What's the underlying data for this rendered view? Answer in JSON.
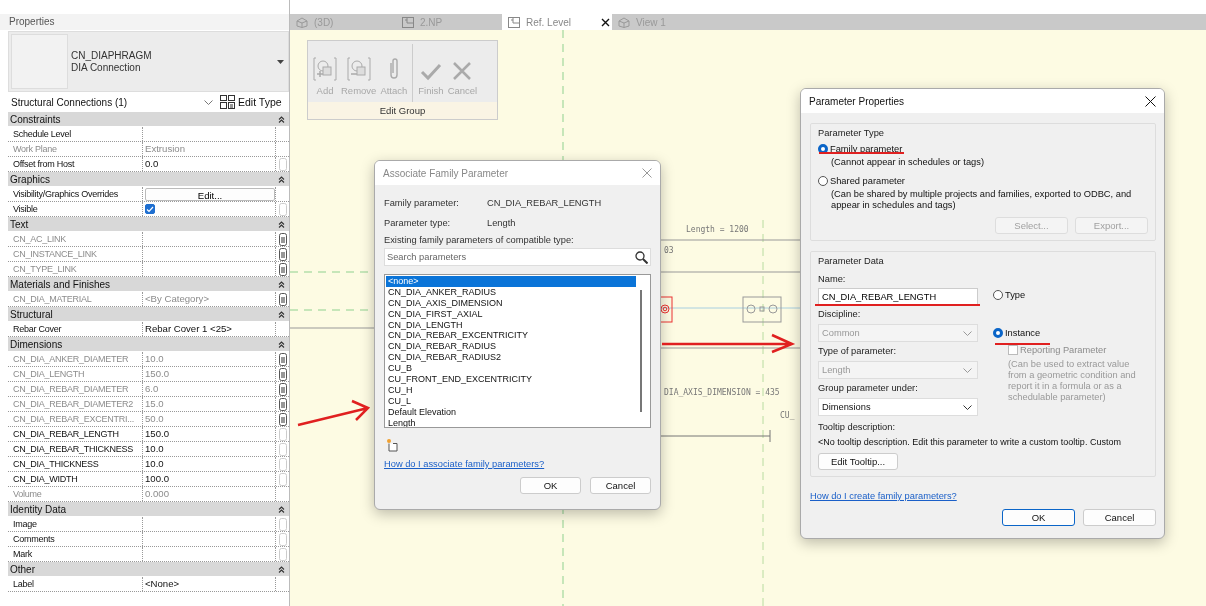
{
  "properties": {
    "title": "Properties",
    "type_name": "CN_DIAPHRAGM",
    "type_sub": "DIA Connection",
    "selector": "Structural Connections (1)",
    "edit_type": "Edit Type",
    "groups": [
      {
        "name": "Constraints",
        "expanded": true,
        "rows": [
          {
            "label": "Schedule Level",
            "kind": "text",
            "disabled": false
          },
          {
            "label": "Work Plane",
            "value": "Extrusion",
            "kind": "text",
            "disabled": true
          },
          {
            "label": "Offset from Host",
            "value": "0.0",
            "kind": "text",
            "disabled": false,
            "linked": false
          }
        ]
      },
      {
        "name": "Graphics",
        "expanded": true,
        "rows": [
          {
            "label": "Visibility/Graphics Overrides",
            "value": "Edit...",
            "kind": "button",
            "disabled": false
          },
          {
            "label": "Visible",
            "kind": "checkbox",
            "checked": true,
            "disabled": false,
            "linked": false
          }
        ]
      },
      {
        "name": "Text",
        "expanded": true,
        "rows": [
          {
            "label": "CN_AC_LINK",
            "kind": "text",
            "disabled": true,
            "linked": true
          },
          {
            "label": "CN_INSTANCE_LINK",
            "kind": "text",
            "disabled": true,
            "linked": true
          },
          {
            "label": "CN_TYPE_LINK",
            "kind": "text",
            "disabled": true,
            "linked": true
          }
        ]
      },
      {
        "name": "Materials and Finishes",
        "expanded": true,
        "rows": [
          {
            "label": "CN_DIA_MATERIAL",
            "value": "<By Category>",
            "kind": "text",
            "disabled": true,
            "linked": true
          }
        ]
      },
      {
        "name": "Structural",
        "expanded": true,
        "rows": [
          {
            "label": "Rebar Cover",
            "value": "Rebar Cover 1 <25>",
            "kind": "text",
            "disabled": false
          }
        ]
      },
      {
        "name": "Dimensions",
        "expanded": true,
        "rows": [
          {
            "label": "CN_DIA_ANKER_DIAMETER",
            "value": "10.0",
            "kind": "text",
            "disabled": true,
            "linked": true
          },
          {
            "label": "CN_DIA_LENGTH",
            "value": "150.0",
            "kind": "text",
            "disabled": true,
            "linked": true
          },
          {
            "label": "CN_DIA_REBAR_DIAMETER",
            "value": "6.0",
            "kind": "text",
            "disabled": true,
            "linked": true
          },
          {
            "label": "CN_DIA_REBAR_DIAMETER2",
            "value": "15.0",
            "kind": "text",
            "disabled": true,
            "linked": true
          },
          {
            "label": "CN_DIA_REBAR_EXCENTRI...",
            "value": "50.0",
            "kind": "text",
            "disabled": true,
            "linked": true
          },
          {
            "label": "CN_DIA_REBAR_LENGTH",
            "value": "150.0",
            "kind": "text",
            "disabled": false,
            "linked": false
          },
          {
            "label": "CN_DIA_REBAR_THICKNESS",
            "value": "10.0",
            "kind": "text",
            "disabled": false,
            "linked": false
          },
          {
            "label": "CN_DIA_THICKNESS",
            "value": "10.0",
            "kind": "text",
            "disabled": false,
            "linked": false
          },
          {
            "label": "CN_DIA_WIDTH",
            "value": "100.0",
            "kind": "text",
            "disabled": false,
            "linked": false
          },
          {
            "label": "Volume",
            "value": "0.000",
            "kind": "text",
            "disabled": true
          }
        ]
      },
      {
        "name": "Identity Data",
        "expanded": true,
        "rows": [
          {
            "label": "Image",
            "kind": "text",
            "disabled": false,
            "linked": false
          },
          {
            "label": "Comments",
            "kind": "text",
            "disabled": false,
            "linked": false
          },
          {
            "label": "Mark",
            "kind": "text",
            "disabled": false,
            "linked": false
          }
        ]
      },
      {
        "name": "Other",
        "expanded": true,
        "rows": [
          {
            "label": "Label",
            "value": "<None>",
            "kind": "text",
            "disabled": false
          }
        ]
      }
    ]
  },
  "tabs": [
    {
      "label": "(3D)",
      "kind": "perspective",
      "selected": false
    },
    {
      "label": "2.NP",
      "kind": "plan",
      "selected": false
    },
    {
      "label": "Ref. Level",
      "kind": "plan",
      "selected": true
    },
    {
      "label": "View 1",
      "kind": "perspective",
      "selected": false
    }
  ],
  "edit_group": {
    "title": "Edit Group",
    "buttons": [
      {
        "label": "Add",
        "kind": "add",
        "disabled": true
      },
      {
        "label": "Remove",
        "kind": "remove",
        "disabled": true
      },
      {
        "label": "Attach",
        "kind": "attach",
        "disabled": true
      },
      {
        "label": "Finish",
        "kind": "finish",
        "disabled": true
      },
      {
        "label": "Cancel",
        "kind": "cancel",
        "disabled": true
      }
    ]
  },
  "canvas": {
    "labels": [
      "Length = 1200",
      "03",
      "DIA_AXIS_DIMENSION = 435",
      "CU_"
    ]
  },
  "associate_dialog": {
    "title": "Associate Family Parameter",
    "active": false,
    "fields": [
      {
        "label": "Family parameter:",
        "value": "CN_DIA_REBAR_LENGTH"
      },
      {
        "label": "Parameter type:",
        "value": "Length"
      }
    ],
    "list_label": "Existing family parameters of compatible type:",
    "search_placeholder": "Search parameters",
    "items": [
      {
        "label": "<none>",
        "selected": true
      },
      {
        "label": "CN_DIA_ANKER_RADIUS",
        "selected": false
      },
      {
        "label": "CN_DIA_AXIS_DIMENSION",
        "selected": false
      },
      {
        "label": "CN_DIA_FIRST_AXIAL",
        "selected": false
      },
      {
        "label": "CN_DIA_LENGTH",
        "selected": false
      },
      {
        "label": "CN_DIA_REBAR_EXCENTRICITY",
        "selected": false
      },
      {
        "label": "CN_DIA_REBAR_RADIUS",
        "selected": false
      },
      {
        "label": "CN_DIA_REBAR_RADIUS2",
        "selected": false
      },
      {
        "label": "CU_B",
        "selected": false
      },
      {
        "label": "CU_FRONT_END_EXCENTRICITY",
        "selected": false
      },
      {
        "label": "CU_H",
        "selected": false
      },
      {
        "label": "CU_L",
        "selected": false
      },
      {
        "label": "Default Elevation",
        "selected": false
      },
      {
        "label": "Length",
        "selected": false
      }
    ],
    "help_link": "How do I associate family parameters?",
    "ok": "OK",
    "cancel": "Cancel"
  },
  "parameter_dialog": {
    "title": "Parameter Properties",
    "active": true,
    "type_legend": "Parameter Type",
    "type_options": [
      {
        "label": "Family parameter",
        "note": "(Cannot appear in schedules or tags)",
        "selected": true
      },
      {
        "label": "Shared parameter",
        "note": "(Can be shared by multiple projects and families, exported to ODBC, and appear in schedules and tags)",
        "selected": false
      }
    ],
    "select_button": {
      "label": "Select...",
      "disabled": true
    },
    "export_button": {
      "label": "Export...",
      "disabled": true
    },
    "data_legend": "Parameter Data",
    "name_label": "Name:",
    "name_value": "CN_DIA_REBAR_LENGTH",
    "scope_options": [
      {
        "label": "Type",
        "selected": false
      },
      {
        "label": "Instance",
        "selected": true
      }
    ],
    "discipline_label": "Discipline:",
    "discipline_value": "Common",
    "discipline_disabled": true,
    "type_label": "Type of parameter:",
    "type_value": "Length",
    "type_disabled": true,
    "group_label": "Group parameter under:",
    "group_value": "Dimensions",
    "group_disabled": false,
    "reporting": {
      "label": "Reporting Parameter",
      "checked": false,
      "disabled": true
    },
    "reporting_note": "(Can be used to extract value from a geometric condition and report it in a formula or as a schedulable parameter)",
    "tooltip_label": "Tooltip description:",
    "tooltip_text": "<No tooltip description. Edit this parameter to write a custom tooltip. Custom",
    "edit_tooltip": "Edit Tooltip...",
    "help_link": "How do I create family parameters?",
    "ok": "OK",
    "cancel": "Cancel"
  }
}
